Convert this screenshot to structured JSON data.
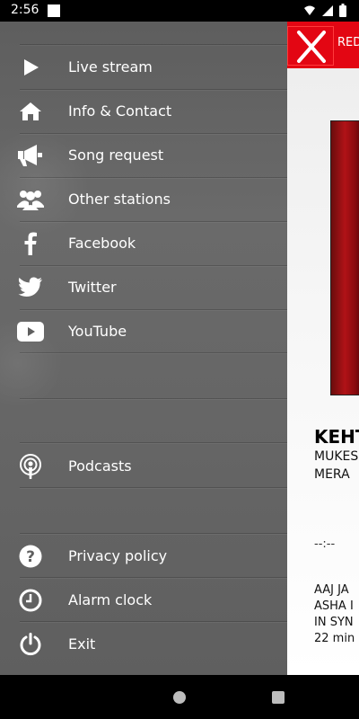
{
  "status": {
    "time": "2:56"
  },
  "content": {
    "top_text": "RED",
    "song_title": "KEHT",
    "song_artist": "MUKES",
    "song_line2": "MERA",
    "time_display": "--:--",
    "next_lines": [
      "AAJ JA",
      "ASHA I",
      "IN SYN",
      "22 min"
    ]
  },
  "menu": [
    {
      "label": "Live stream",
      "icon": "play-icon"
    },
    {
      "label": "Info & Contact",
      "icon": "home-icon"
    },
    {
      "label": "Song request",
      "icon": "megaphone-icon"
    },
    {
      "label": "Other stations",
      "icon": "group-icon"
    },
    {
      "label": "Facebook",
      "icon": "facebook-icon"
    },
    {
      "label": "Twitter",
      "icon": "twitter-icon"
    },
    {
      "label": "YouTube",
      "icon": "youtube-icon"
    },
    {
      "label": "Podcasts",
      "icon": "podcast-icon"
    },
    {
      "label": "Privacy policy",
      "icon": "help-icon"
    },
    {
      "label": "Alarm clock",
      "icon": "clock-icon"
    },
    {
      "label": "Exit",
      "icon": "power-icon"
    }
  ],
  "colors": {
    "accent": "#e30613",
    "drawer": "#666666"
  }
}
